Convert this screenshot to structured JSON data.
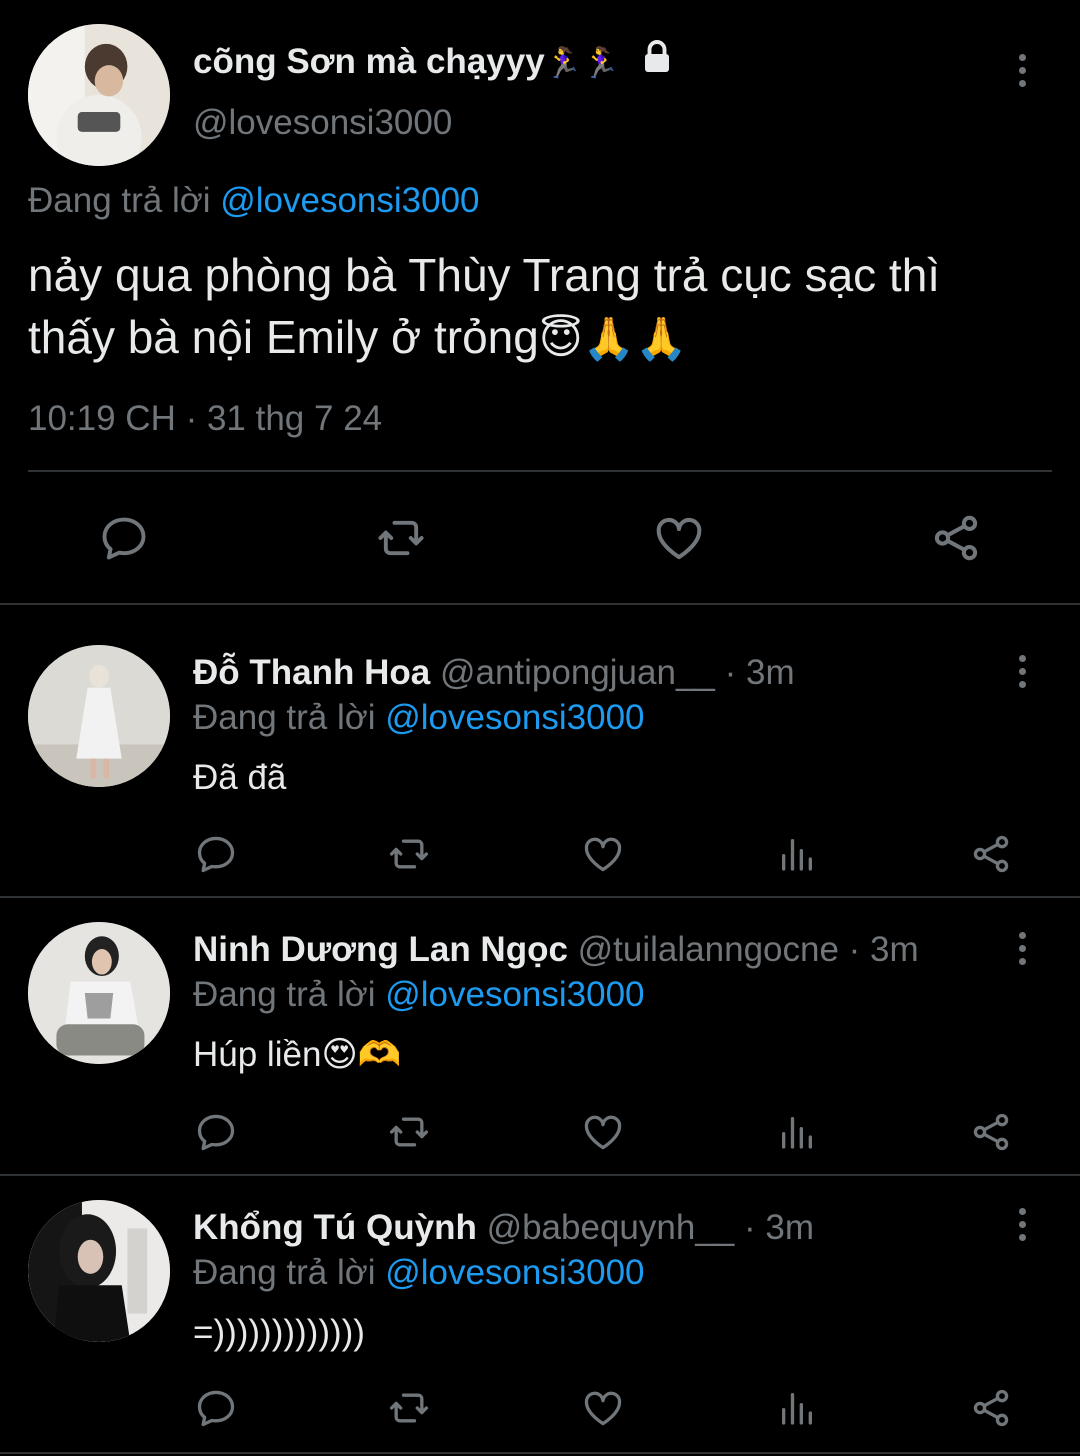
{
  "main_tweet": {
    "display_name": "cõng Sơn mà chạyyy",
    "name_emoji": "🏃‍♀️🏃‍♀️",
    "handle": "@lovesonsi3000",
    "reply_prefix": "Đang trả lời ",
    "reply_to": "@lovesonsi3000",
    "text_line1": "nảy qua phòng bà Thùy Trang trả cục sạc thì",
    "text_line2": "thấy bà nội Emily ở trỏng",
    "text_emoji": "😇🙏🙏",
    "timestamp": "10:19 CH · 31 thg 7 24"
  },
  "replies": [
    {
      "display_name": "Đỗ Thanh Hoa",
      "handle": "@antipongjuan__",
      "time": "· 3m",
      "reply_prefix": "Đang trả lời ",
      "reply_to": "@lovesonsi3000",
      "text": "Đã đã",
      "text_emoji": ""
    },
    {
      "display_name": "Ninh Dương Lan Ngọc",
      "handle": "@tuilalanngocne",
      "time": "· 3m",
      "reply_prefix": "Đang trả lời ",
      "reply_to": "@lovesonsi3000",
      "text": "Húp liền",
      "text_emoji": "😍🫶"
    },
    {
      "display_name": "Khổng Tú Quỳnh",
      "handle": "@babequynh__",
      "time": "· 3m",
      "reply_prefix": "Đang trả lời ",
      "reply_to": "@lovesonsi3000",
      "text": "=)))))))))))))",
      "text_emoji": ""
    }
  ],
  "icons": {
    "reply": "comment-icon",
    "retweet": "retweet-icon",
    "like": "heart-icon",
    "views": "analytics-icon",
    "share": "share-icon",
    "more": "more-icon",
    "lock": "lock-icon"
  },
  "colors": {
    "background": "#000000",
    "text": "#e7e9ea",
    "secondary": "#71767b",
    "link": "#1d9bf0",
    "divider": "#2f3336"
  }
}
